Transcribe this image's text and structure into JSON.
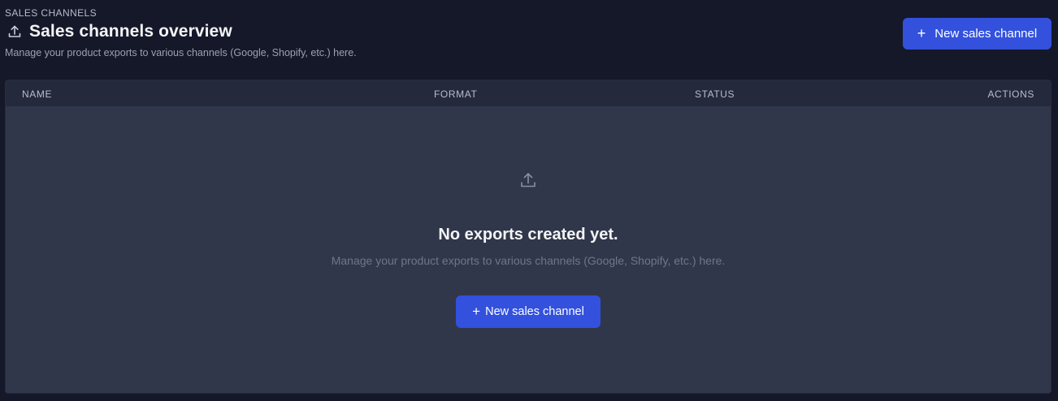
{
  "header": {
    "breadcrumb": "SALES CHANNELS",
    "title": "Sales channels overview",
    "subtitle": "Manage your product exports to various channels (Google, Shopify, etc.) here.",
    "new_button_label": "New sales channel",
    "title_icon": "upload-icon"
  },
  "table": {
    "columns": [
      "NAME",
      "FORMAT",
      "STATUS",
      "ACTIONS"
    ],
    "rows": []
  },
  "empty_state": {
    "icon": "upload-icon",
    "title": "No exports created yet.",
    "description": "Manage your product exports to various channels (Google, Shopify, etc.) here.",
    "button_label": "New sales channel"
  },
  "colors": {
    "background": "#151829",
    "card": "#31374a",
    "table_header": "#242a3c",
    "accent": "#3351dc"
  }
}
